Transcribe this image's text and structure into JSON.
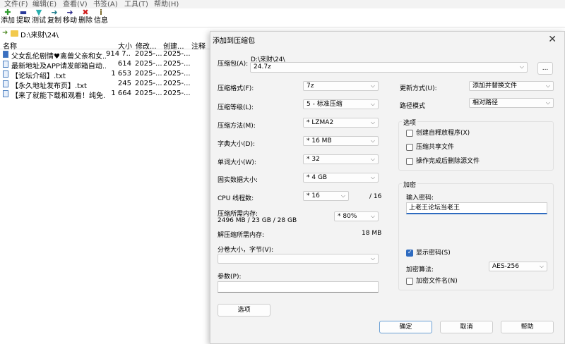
{
  "menu": [
    "文件(F)",
    "编辑(E)",
    "查看(V)",
    "书签(A)",
    "工具(T)",
    "帮助(H)"
  ],
  "toolbar": [
    {
      "label": "添加",
      "icon": "plus-icon",
      "glyph": "✚",
      "color": "#2e9b2e"
    },
    {
      "label": "提取",
      "icon": "minus-icon",
      "glyph": "▬",
      "color": "#2a3a9a"
    },
    {
      "label": "测试",
      "icon": "check-icon",
      "glyph": "▼",
      "color": "#2ab0b0"
    },
    {
      "label": "复制",
      "icon": "copy-arrow-icon",
      "glyph": "➜",
      "color": "#1a7a8a"
    },
    {
      "label": "移动",
      "icon": "move-arrow-icon",
      "glyph": "➜",
      "color": "#2a2a8a"
    },
    {
      "label": "删除",
      "icon": "delete-icon",
      "glyph": "✖",
      "color": "#d02020"
    },
    {
      "label": "信息",
      "icon": "info-icon",
      "glyph": "i",
      "color": "#7a6a2a"
    }
  ],
  "address": "D:\\来财\\24\\",
  "columns": {
    "name": "名称",
    "size": "大小",
    "modified": "修改...",
    "created": "创建...",
    "comment": "注释"
  },
  "files": [
    {
      "name": "父女乱伦剧情♥禽兽父亲和女...",
      "size": "914 7...",
      "modified": "2025-...",
      "created": "2025-...",
      "type": "app"
    },
    {
      "name": "最新地址及APP请发邮箱自动...",
      "size": "614",
      "modified": "2025-...",
      "created": "2025-...",
      "type": "txt"
    },
    {
      "name": "【论坛介绍】.txt",
      "size": "1 653",
      "modified": "2025-...",
      "created": "2025-...",
      "type": "txt"
    },
    {
      "name": "【永久地址发布页】.txt",
      "size": "245",
      "modified": "2025-...",
      "created": "2025-...",
      "type": "txt"
    },
    {
      "name": "【来了就能下载和观看！纯免...",
      "size": "1 664",
      "modified": "2025-...",
      "created": "2025-...",
      "type": "txt"
    }
  ],
  "dialog": {
    "title": "添加到压缩包",
    "archive_label": "压缩包(A):",
    "archive_dir": "D:\\来财\\24\\",
    "archive_name": "24.7z",
    "browse_label": "...",
    "format_label": "压缩格式(F):",
    "format_value": "7z",
    "level_label": "压缩等级(L):",
    "level_value": "5 - 标准压缩",
    "method_label": "压缩方法(M):",
    "method_value": "*  LZMA2",
    "dict_label": "字典大小(D):",
    "dict_value": "*  16 MB",
    "word_label": "单词大小(W):",
    "word_value": "*  32",
    "solid_label": "固实数据大小:",
    "solid_value": "*  4 GB",
    "threads_label": "CPU 线程数:",
    "threads_value": "*  16",
    "threads_total": "/ 16",
    "mem_comp_label": "压缩所需内存:",
    "mem_comp_value": "2496 MB / 23 GB / 28 GB",
    "mem_percent": "* 80%",
    "mem_decomp_label": "解压缩所需内存:",
    "mem_decomp_value": "18 MB",
    "split_label": "分卷大小，字节(V):",
    "split_value": "",
    "params_label": "参数(P):",
    "params_value": "",
    "options_button": "选项",
    "update_label": "更新方式(U):",
    "update_value": "添加并替换文件",
    "path_label": "路径模式",
    "path_value": "相对路径",
    "options_group": "选项",
    "opt_sfx": "创建自释放程序(X)",
    "opt_shared": "压缩共享文件",
    "opt_delete": "操作完成后删除源文件",
    "encrypt_group": "加密",
    "password_label": "输入密码:",
    "password_value": "上老王论坛当老王",
    "show_password": "显示密码(S)",
    "enc_method_label": "加密算法:",
    "enc_method_value": "AES-256",
    "enc_names": "加密文件名(N)",
    "ok": "确定",
    "cancel": "取消",
    "help": "帮助"
  }
}
